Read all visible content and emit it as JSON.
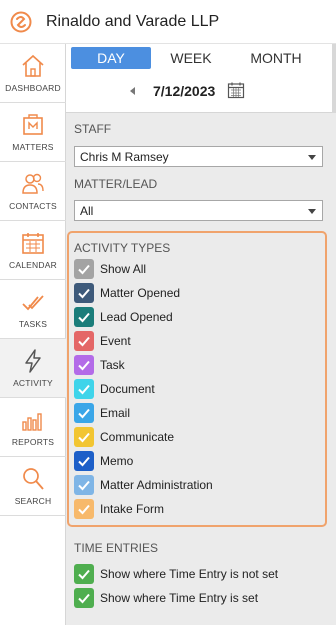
{
  "header": {
    "firm_name": "Rinaldo and Varade LLP"
  },
  "nav": {
    "items": [
      {
        "name": "dashboard",
        "label": "DASHBOARD"
      },
      {
        "name": "matters",
        "label": "MATTERS"
      },
      {
        "name": "contacts",
        "label": "CONTACTS"
      },
      {
        "name": "calendar",
        "label": "CALENDAR"
      },
      {
        "name": "tasks",
        "label": "TASKS"
      },
      {
        "name": "activity",
        "label": "ACTIVITY",
        "active": true
      },
      {
        "name": "reports",
        "label": "REPORTS"
      },
      {
        "name": "search",
        "label": "SEARCH"
      }
    ]
  },
  "view_tabs": {
    "day": "DAY",
    "week": "WEEK",
    "month": "MONTH",
    "selected": "DAY"
  },
  "date": {
    "value": "7/12/2023"
  },
  "staff": {
    "title": "STAFF",
    "selected": "Chris M Ramsey"
  },
  "matter_lead": {
    "title": "MATTER/LEAD",
    "selected": "All"
  },
  "activity_types": {
    "title": "ACTIVITY TYPES",
    "items": [
      {
        "label": "Show All",
        "color": "#a3a3a3",
        "checked": true
      },
      {
        "label": "Matter Opened",
        "color": "#3e5a7a",
        "checked": true
      },
      {
        "label": "Lead Opened",
        "color": "#1b7d7a",
        "checked": true
      },
      {
        "label": "Event",
        "color": "#e46767",
        "checked": true
      },
      {
        "label": "Task",
        "color": "#b36be8",
        "checked": true
      },
      {
        "label": "Document",
        "color": "#3fd4ea",
        "checked": true
      },
      {
        "label": "Email",
        "color": "#3aa6e8",
        "checked": true
      },
      {
        "label": "Communicate",
        "color": "#f2c531",
        "checked": true
      },
      {
        "label": "Memo",
        "color": "#1d5fc8",
        "checked": true
      },
      {
        "label": "Matter Administration",
        "color": "#7fb5e6",
        "checked": true
      },
      {
        "label": "Intake Form",
        "color": "#f7b96b",
        "checked": true
      }
    ]
  },
  "time_entries": {
    "title": "TIME ENTRIES",
    "items": [
      {
        "label": "Show where Time Entry is not set",
        "color": "#4fae4f",
        "checked": true
      },
      {
        "label": "Show where Time Entry is set",
        "color": "#4fae4f",
        "checked": true
      }
    ]
  }
}
